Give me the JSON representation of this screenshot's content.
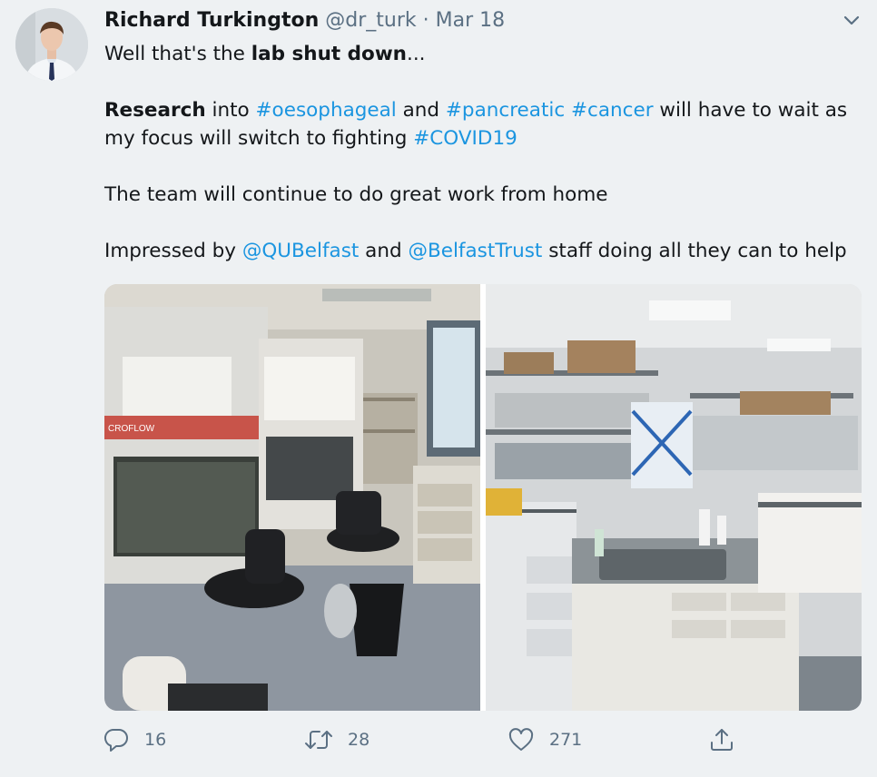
{
  "author": {
    "name": "Richard Turkington",
    "handle": "@dr_turk",
    "separator": "·",
    "date": "Mar 18"
  },
  "tweet": {
    "line1_prefix": "Well that's the ",
    "line1_bold": "lab shut down",
    "line1_suffix": "...",
    "line2_bold": "Research",
    "line2_into": " into ",
    "tag_oesophageal": "#oesophageal",
    "line2_and": " and ",
    "tag_pancreatic": "#pancreatic",
    "line2_space": " ",
    "tag_cancer": "#cancer",
    "line2_suffix": " will have to wait as",
    "line3_prefix": "my focus will switch to fighting ",
    "tag_covid": "#COVID19",
    "line4": "The team will continue to do great work from home",
    "line5_prefix": "Impressed by ",
    "mention_qub": "@QUBelfast",
    "line5_and": " and ",
    "mention_trust": "@BelfastTrust",
    "line5_suffix": " staff doing all they can to help"
  },
  "media": {
    "left_photo_label": "CROFLOW"
  },
  "actions": {
    "replies": "16",
    "retweets": "28",
    "likes": "271"
  },
  "icons": [
    "more-chevron-icon",
    "reply-icon",
    "retweet-icon",
    "like-icon",
    "share-icon"
  ],
  "colors": {
    "link": "#1b95e0",
    "secondary": "#5b7083",
    "background": "#eef1f3"
  }
}
